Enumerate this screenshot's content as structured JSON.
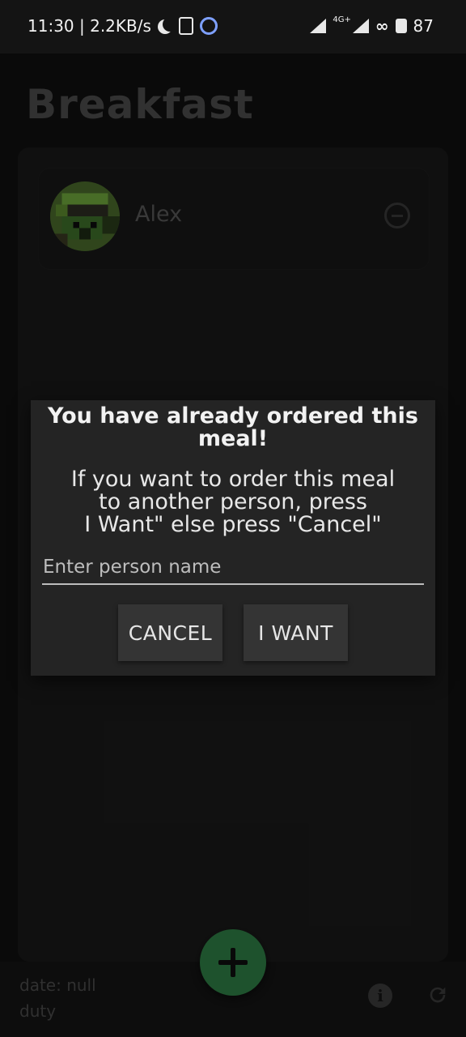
{
  "status_bar": {
    "left_text": "11:30 | 2.2KB/s",
    "network_label": "4G+",
    "battery_level": "87",
    "icons": [
      "moon-icon",
      "vibrate-icon",
      "vpn-icon",
      "signal-icon",
      "signal-4g-icon",
      "sync-icon",
      "battery-icon"
    ]
  },
  "header": {
    "title": "Breakfast"
  },
  "people": [
    {
      "name": "Alex",
      "avatar": "pixel-avatar"
    }
  ],
  "dialog": {
    "title": "You have already ordered this meal!",
    "message_lines": [
      "If you want to order this meal",
      "to another person, press",
      "I Want\" else press \"Cancel\""
    ],
    "input_placeholder": "Enter person name",
    "input_value": "",
    "cancel_label": "CANCEL",
    "want_label": "I WANT"
  },
  "footer": {
    "date_label": "date: null",
    "duty_label": "duty",
    "info_icon_glyph": "i"
  },
  "colors": {
    "fab": "#2f7f45",
    "dialog_bg": "#242424",
    "background": "#101010"
  }
}
